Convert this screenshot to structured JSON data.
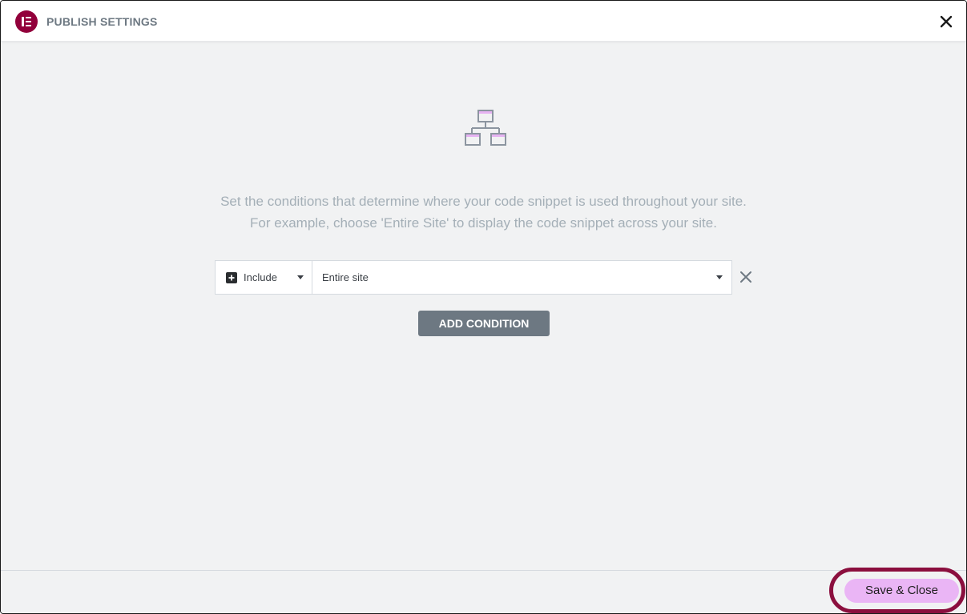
{
  "header": {
    "title": "PUBLISH SETTINGS",
    "logo_icon": "elementor-logo",
    "close_icon": "close-icon"
  },
  "main": {
    "hero_icon": "sitemap-icon",
    "description_line1": "Set the conditions that determine where your code snippet is used throughout your site.",
    "description_line2": "For example, choose 'Entire Site' to display the code snippet across your site."
  },
  "condition": {
    "type_value": "Include",
    "type_icon": "plus-square-icon",
    "scope_value": "Entire site",
    "remove_icon": "close-icon"
  },
  "add_condition_label": "ADD CONDITION",
  "footer": {
    "save_label": "Save & Close"
  },
  "colors": {
    "brand": "#92003b",
    "highlight_outline": "#8b0f3e",
    "save_button": "#eab5f5",
    "add_button": "#6d7882"
  }
}
